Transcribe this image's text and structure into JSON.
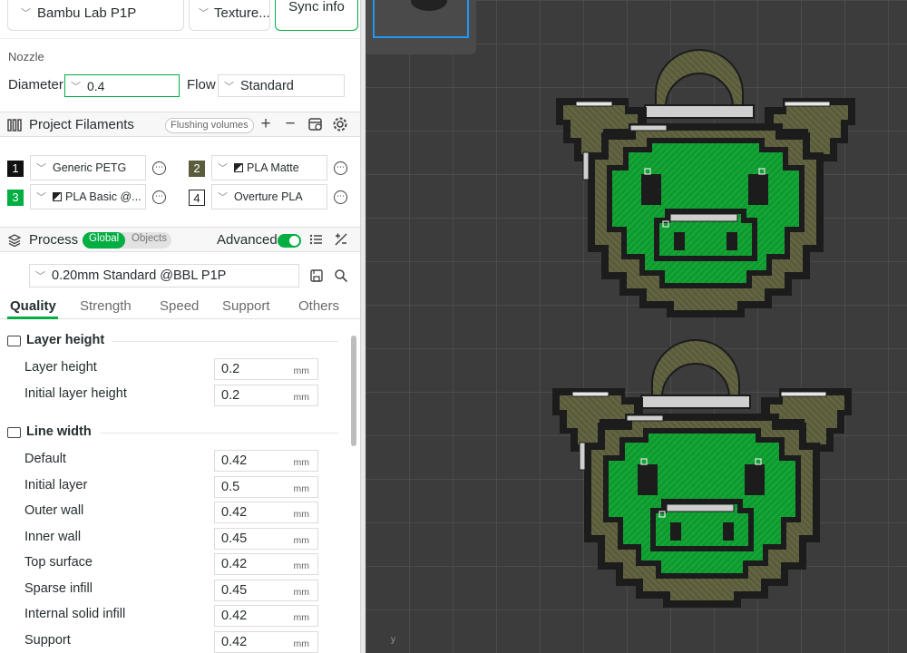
{
  "printer": {
    "name": "Bambu Lab P1P",
    "plate": "Texture...",
    "sync_label": "Sync info"
  },
  "nozzle": {
    "title": "Nozzle",
    "diameter_label": "Diameter",
    "diameter_value": "0.4",
    "flow_label": "Flow",
    "flow_value": "Standard"
  },
  "filaments": {
    "title": "Project Filaments",
    "flushing_label": "Flushing volumes",
    "items": [
      {
        "num": "1",
        "name": "Generic PETG",
        "color": "#111111"
      },
      {
        "num": "2",
        "name": "PLA Matte",
        "color": "#5a5c3c"
      },
      {
        "num": "3",
        "name": "PLA Basic @...",
        "color": "#00ae42"
      },
      {
        "num": "4",
        "name": "Overture PLA",
        "color": "#ffffff"
      }
    ]
  },
  "process": {
    "title": "Process",
    "global_label": "Global",
    "objects_label": "Objects",
    "advanced_label": "Advanced",
    "preset": "0.20mm Standard @BBL P1P",
    "tabs": [
      "Quality",
      "Strength",
      "Speed",
      "Support",
      "Others"
    ]
  },
  "groups": {
    "layer_height": {
      "title": "Layer height",
      "rows": [
        {
          "label": "Layer height",
          "value": "0.2",
          "unit": "mm"
        },
        {
          "label": "Initial layer height",
          "value": "0.2",
          "unit": "mm"
        }
      ]
    },
    "line_width": {
      "title": "Line width",
      "rows": [
        {
          "label": "Default",
          "value": "0.42",
          "unit": "mm"
        },
        {
          "label": "Initial layer",
          "value": "0.5",
          "unit": "mm"
        },
        {
          "label": "Outer wall",
          "value": "0.42",
          "unit": "mm"
        },
        {
          "label": "Inner wall",
          "value": "0.45",
          "unit": "mm"
        },
        {
          "label": "Top surface",
          "value": "0.42",
          "unit": "mm"
        },
        {
          "label": "Sparse infill",
          "value": "0.45",
          "unit": "mm"
        },
        {
          "label": "Internal solid infill",
          "value": "0.42",
          "unit": "mm"
        },
        {
          "label": "Support",
          "value": "0.42",
          "unit": "mm"
        }
      ]
    }
  },
  "viewport": {
    "axis_label": "y"
  },
  "colors": {
    "accent": "#00ae42",
    "pig_green": "#0f9a30",
    "pig_olive": "#5a5c3c",
    "pig_dark": "#1c1c1c",
    "bed": "#3c3c3c"
  }
}
